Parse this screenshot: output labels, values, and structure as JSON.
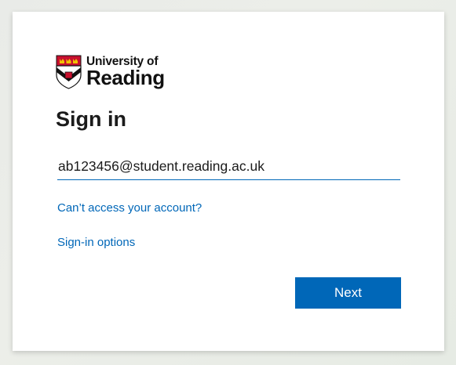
{
  "logo": {
    "line1": "University of",
    "line2": "Reading",
    "crest_icon": "university-crest-icon"
  },
  "signin": {
    "title": "Sign in",
    "email_value": "ab123456@student.reading.ac.uk",
    "cant_access_link": "Can’t access your account?",
    "signin_options_link": "Sign-in options",
    "next_label": "Next"
  },
  "colors": {
    "accent": "#0067b8",
    "card_bg": "#ffffff",
    "text": "#1b1b1b"
  }
}
